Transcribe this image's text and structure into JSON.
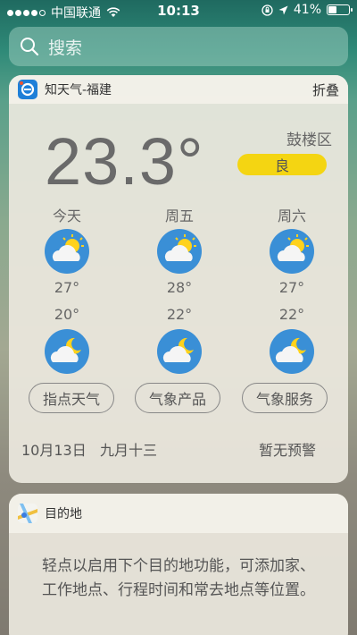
{
  "status_bar": {
    "carrier": "中国联通",
    "time": "10:13",
    "battery": "41%",
    "signal_strength": 4,
    "battery_level": 0.41
  },
  "search": {
    "placeholder": "搜索"
  },
  "weather_widget": {
    "app_name": "知天气-福建",
    "collapse_label": "折叠",
    "current_temp": "23.3°",
    "district": "鼓楼区",
    "aqi_label": "良",
    "aqi_color": "#f4d512",
    "forecast": [
      {
        "day": "今天",
        "high": "27°",
        "low": "20°",
        "day_icon": "partly-cloudy-day-icon",
        "night_icon": "partly-cloudy-night-icon"
      },
      {
        "day": "周五",
        "high": "28°",
        "low": "22°",
        "day_icon": "partly-cloudy-day-icon",
        "night_icon": "partly-cloudy-night-icon"
      },
      {
        "day": "周六",
        "high": "27°",
        "low": "22°",
        "day_icon": "partly-cloudy-day-icon",
        "night_icon": "partly-cloudy-night-icon"
      }
    ],
    "buttons": [
      "指点天气",
      "气象产品",
      "气象服务"
    ],
    "date": "10月13日",
    "lunar_date": "九月十三",
    "warning": "暂无预警"
  },
  "destination_widget": {
    "app_name": "目的地",
    "description": "轻点以启用下个目的地功能，可添加家、工作地点、行程时间和常去地点等位置。"
  }
}
